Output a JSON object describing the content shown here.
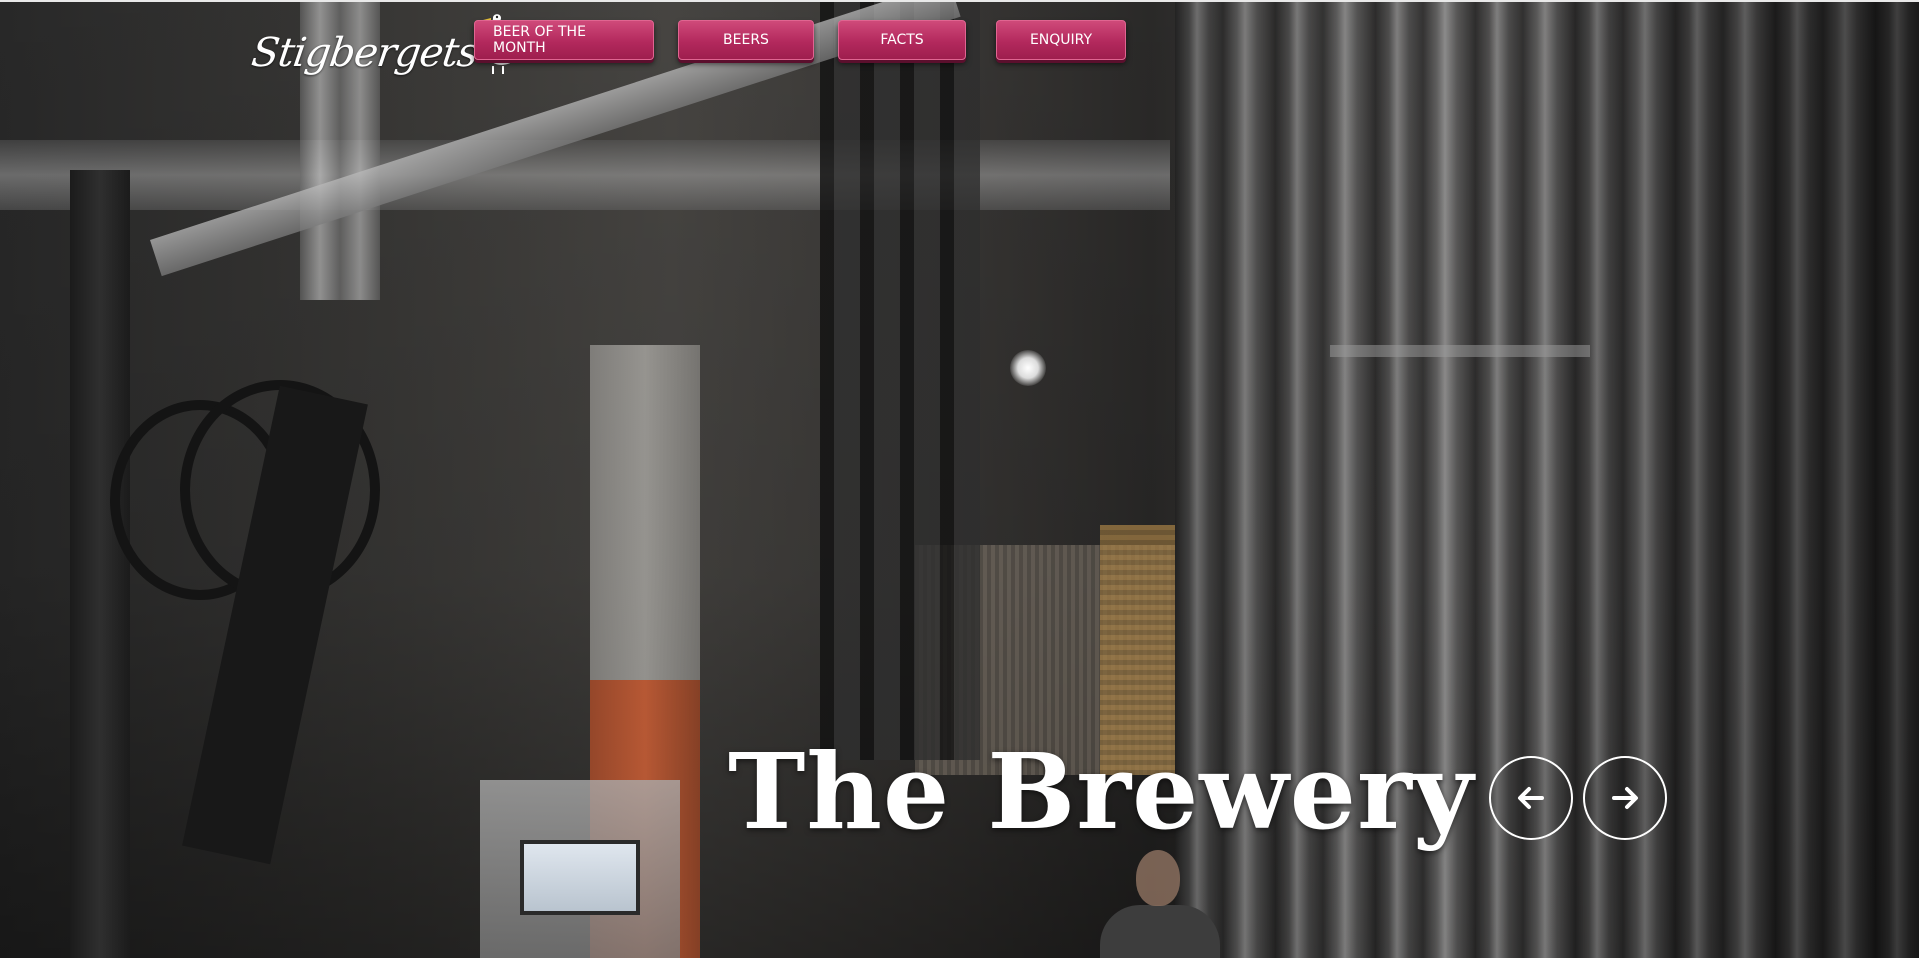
{
  "brand": {
    "logo_text": "Stigbergets",
    "logo_icon": "duck-bird-icon"
  },
  "nav": {
    "items": [
      {
        "label": "BEER OF THE MONTH"
      },
      {
        "label": "BEERS"
      },
      {
        "label": "FACTS"
      },
      {
        "label": "ENQUIRY"
      }
    ],
    "button_color": "#b3295d"
  },
  "hero": {
    "title": "The Brewery",
    "prev_icon": "arrow-left-icon",
    "next_icon": "arrow-right-icon"
  }
}
